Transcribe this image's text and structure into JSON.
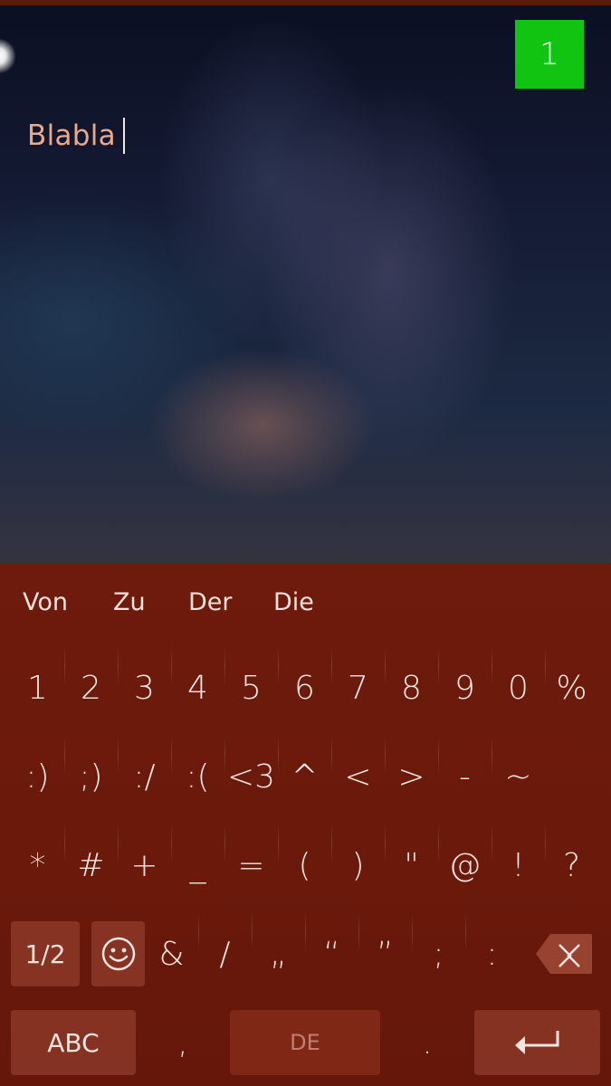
{
  "screen": {
    "counter": "1",
    "text_value": "Blabla"
  },
  "keyboard": {
    "predictions": [
      "Von",
      "Zu",
      "Der",
      "Die"
    ],
    "row1": [
      "1",
      "2",
      "3",
      "4",
      "5",
      "6",
      "7",
      "8",
      "9",
      "0",
      "%"
    ],
    "row2": [
      ":)",
      ";)",
      ":/",
      ":(",
      "<3",
      "^",
      "<",
      ">",
      "-",
      "~"
    ],
    "row3": [
      "*",
      "#",
      "+",
      "_",
      "=",
      "(",
      ")",
      "\"",
      "@",
      "!",
      "?"
    ],
    "row4": [
      "&",
      "/",
      "„",
      "“",
      "”",
      ";",
      ":"
    ],
    "page_label": "1/2",
    "abc_label": "ABC",
    "comma": ",",
    "space_label": "DE",
    "period": ".",
    "icons": {
      "emoji": "smiley-icon",
      "backspace": "backspace-icon",
      "enter": "enter-icon"
    },
    "colors": {
      "counter_bg": "#11c411",
      "keyboard_bg": "#6a190b",
      "text_color": "#e8a98c"
    }
  }
}
